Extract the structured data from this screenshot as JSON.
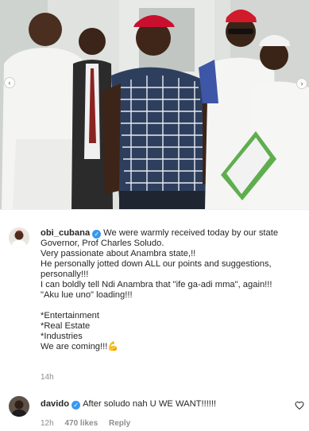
{
  "post": {
    "image_alt": "Group photo of men standing outside a building",
    "carousel": {
      "prev_icon": "chevron-left-icon",
      "next_icon": "chevron-right-icon"
    }
  },
  "caption": {
    "username": "obi_cubana",
    "verified_icon": "verified-badge-icon",
    "lines": [
      "We were warmly received today by our state",
      "Governor, Prof Charles Soludo.",
      "Very passionate about Anambra state,!!",
      "He personally jotted down ALL our points and suggestions,",
      "personally!!!",
      "I can boldly tell Ndi Anambra that \"ife ga-adi mma\", again!!!",
      "\"Aku lue uno\" loading!!!",
      "",
      "*Entertainment",
      "*Real Estate",
      "*Industries",
      "We are coming!!!"
    ],
    "final_emoji": "💪",
    "time": "14h"
  },
  "comment": {
    "username": "davido",
    "verified_icon": "verified-badge-icon",
    "text": "After soludo nah U WE WANT!!!!!!",
    "time": "12h",
    "likes": "470 likes",
    "reply_label": "Reply",
    "like_icon": "heart-outline-icon"
  },
  "colors": {
    "text": "#262626",
    "meta": "#8e8e8e",
    "verified": "#3897f0"
  }
}
